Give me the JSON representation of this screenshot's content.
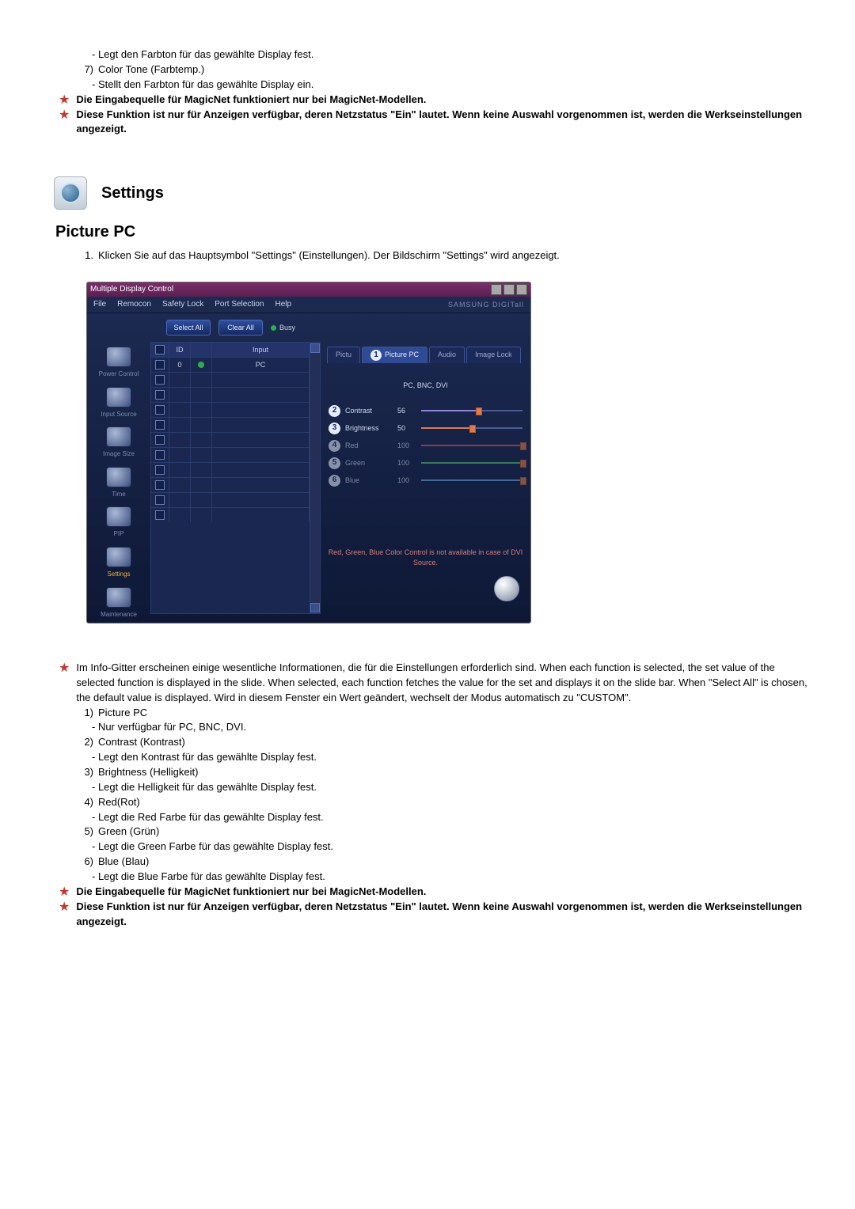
{
  "top_text": {
    "color_tint_desc": "- Legt den Farbton für das gewählte Display fest.",
    "item7_num": "7)",
    "item7_label": "Color Tone (Farbtemp.)",
    "item7_desc": "- Stellt den Farbton für das gewählte Display ein.",
    "star1": "Die Eingabequelle für MagicNet funktioniert nur bei MagicNet-Modellen.",
    "star2": "Diese Funktion ist nur für Anzeigen verfügbar, deren Netzstatus \"Ein\" lautet. Wenn keine Auswahl vorgenommen ist, werden die Werkseinstellungen angezeigt."
  },
  "headings": {
    "settings": "Settings",
    "picture_pc": "Picture PC",
    "step1_num": "1.",
    "step1": "Klicken Sie auf das Hauptsymbol \"Settings\" (Einstellungen). Der Bildschirm \"Settings\" wird angezeigt."
  },
  "app": {
    "title": "Multiple Display Control",
    "brand": "SAMSUNG DIGITall",
    "menu": [
      "File",
      "Remocon",
      "Safety Lock",
      "Port Selection",
      "Help"
    ],
    "toolbar": {
      "select_all": "Select All",
      "clear_all": "Clear All",
      "busy": "Busy"
    },
    "sidebar": [
      {
        "label": "Power Control",
        "active": false
      },
      {
        "label": "Input Source",
        "active": false
      },
      {
        "label": "Image Size",
        "active": false
      },
      {
        "label": "Time",
        "active": false
      },
      {
        "label": "PIP",
        "active": false
      },
      {
        "label": "Settings",
        "active": true
      },
      {
        "label": "Maintenance",
        "active": false
      }
    ],
    "grid": {
      "headers": {
        "chk": "☑",
        "id": "ID",
        "st": " ",
        "input": "Input"
      },
      "rows": [
        {
          "id": "0",
          "status": "on",
          "input": "PC"
        },
        {
          "id": "",
          "status": "",
          "input": ""
        },
        {
          "id": "",
          "status": "",
          "input": ""
        },
        {
          "id": "",
          "status": "",
          "input": ""
        },
        {
          "id": "",
          "status": "",
          "input": ""
        },
        {
          "id": "",
          "status": "",
          "input": ""
        },
        {
          "id": "",
          "status": "",
          "input": ""
        },
        {
          "id": "",
          "status": "",
          "input": ""
        },
        {
          "id": "",
          "status": "",
          "input": ""
        },
        {
          "id": "",
          "status": "",
          "input": ""
        },
        {
          "id": "",
          "status": "",
          "input": ""
        }
      ]
    },
    "tabs": {
      "picture": "Pictu",
      "tab1_num": "1",
      "picture_pc": "Picture PC",
      "audio": "Audio",
      "image_lock": "Image Lock"
    },
    "subhead": "PC, BNC, DVI",
    "sliders": [
      {
        "n": "2",
        "label": "Contrast",
        "value": 56,
        "pct": 56,
        "color": "#8e86d8",
        "muted": false
      },
      {
        "n": "3",
        "label": "Brightness",
        "value": 50,
        "pct": 50,
        "color": "#d87a59",
        "muted": false
      },
      {
        "n": "4",
        "label": "Red",
        "value": 100,
        "pct": 100,
        "color": "#e05656",
        "muted": true
      },
      {
        "n": "5",
        "label": "Green",
        "value": 100,
        "pct": 100,
        "color": "#59c46d",
        "muted": true
      },
      {
        "n": "6",
        "label": "Blue",
        "value": 100,
        "pct": 100,
        "color": "#6aa6e2",
        "muted": true
      }
    ],
    "footnote": "Red, Green, Blue Color Control is not available in case of DVI Source."
  },
  "info_block": {
    "star_intro": "Im Info-Gitter erscheinen einige wesentliche Informationen, die für die Einstellungen erforderlich sind. When each function is selected, the set value of the selected function is displayed in the slide. When selected, each function fetches the value for the set and displays it on the slide bar. When \"Select All\" is chosen, the default value is displayed. Wird in diesem Fenster ein Wert geändert, wechselt der Modus automatisch zu \"CUSTOM\".",
    "items": [
      {
        "n": "1)",
        "label": "Picture PC",
        "desc": "- Nur verfügbar für PC, BNC, DVI."
      },
      {
        "n": "2)",
        "label": "Contrast (Kontrast)",
        "desc": "- Legt den Kontrast für das gewählte Display fest."
      },
      {
        "n": "3)",
        "label": "Brightness (Helligkeit)",
        "desc": "- Legt die Helligkeit für das gewählte Display fest."
      },
      {
        "n": "4)",
        "label": "Red(Rot)",
        "desc": "- Legt die Red Farbe für das gewählte Display fest."
      },
      {
        "n": "5)",
        "label": "Green (Grün)",
        "desc": "- Legt die Green Farbe für das gewählte Display fest."
      },
      {
        "n": "6)",
        "label": "Blue (Blau)",
        "desc": "- Legt die Blue Farbe für das gewählte Display fest."
      }
    ],
    "star1": "Die Eingabequelle für MagicNet funktioniert nur bei MagicNet-Modellen.",
    "star2": "Diese Funktion ist nur für Anzeigen verfügbar, deren Netzstatus \"Ein\" lautet. Wenn keine Auswahl vorgenommen ist, werden die Werkseinstellungen angezeigt."
  }
}
